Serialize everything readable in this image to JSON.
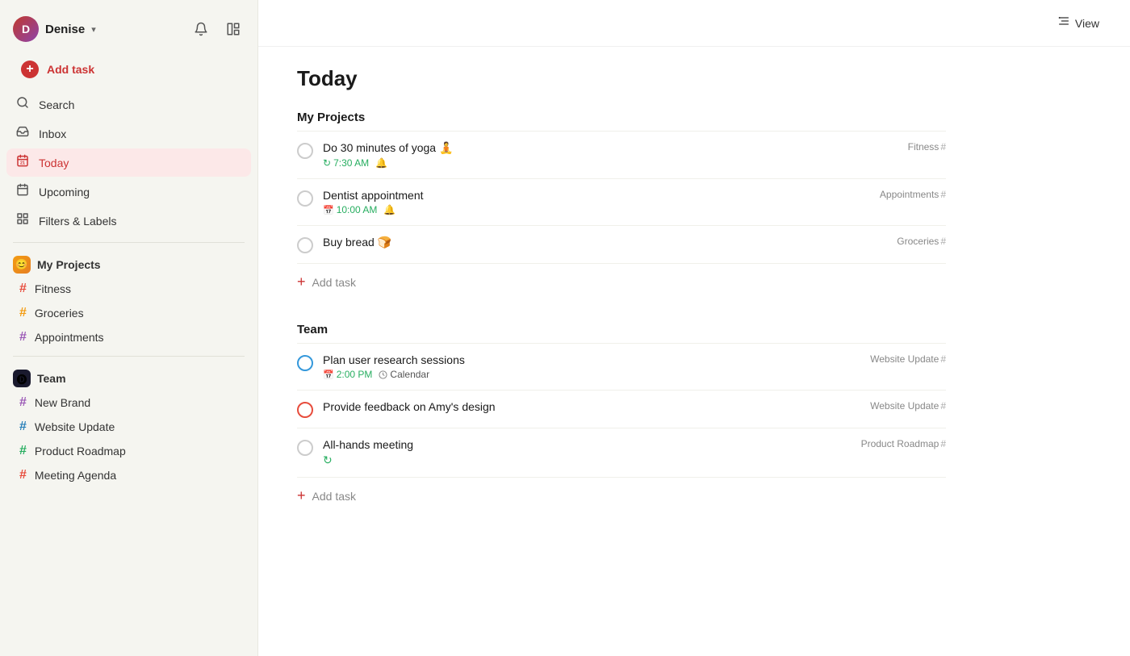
{
  "sidebar": {
    "user": {
      "name": "Denise",
      "initials": "D",
      "avatar_emoji": "😊"
    },
    "nav": [
      {
        "id": "add-task",
        "label": "Add task",
        "icon": "➕",
        "type": "action"
      },
      {
        "id": "search",
        "label": "Search",
        "icon": "🔍"
      },
      {
        "id": "inbox",
        "label": "Inbox",
        "icon": "📥"
      },
      {
        "id": "today",
        "label": "Today",
        "icon": "📅",
        "active": true
      },
      {
        "id": "upcoming",
        "label": "Upcoming",
        "icon": "📆"
      },
      {
        "id": "filters",
        "label": "Filters & Labels",
        "icon": "⊞"
      }
    ],
    "my_projects": {
      "label": "My Projects",
      "items": [
        {
          "id": "fitness",
          "label": "Fitness",
          "hash_color": "fitness"
        },
        {
          "id": "groceries",
          "label": "Groceries",
          "hash_color": "groceries"
        },
        {
          "id": "appointments",
          "label": "Appointments",
          "hash_color": "appointments"
        }
      ]
    },
    "team": {
      "label": "Team",
      "items": [
        {
          "id": "new-brand",
          "label": "New Brand",
          "hash_color": "new-brand"
        },
        {
          "id": "website-update",
          "label": "Website Update",
          "hash_color": "website"
        },
        {
          "id": "product-roadmap",
          "label": "Product Roadmap",
          "hash_color": "product"
        },
        {
          "id": "meeting-agenda",
          "label": "Meeting Agenda",
          "hash_color": "meeting"
        }
      ]
    }
  },
  "main": {
    "title": "Today",
    "view_button": "View",
    "my_projects_section": {
      "label": "My Projects",
      "tasks": [
        {
          "id": 1,
          "name": "Do 30 minutes of yoga 🧘",
          "time": "7:30 AM",
          "has_alarm": true,
          "tag": "Fitness"
        },
        {
          "id": 2,
          "name": "Dentist appointment",
          "time": "10:00 AM",
          "has_alarm": true,
          "tag": "Appointments"
        },
        {
          "id": 3,
          "name": "Buy bread 🍞",
          "time": null,
          "has_alarm": false,
          "tag": "Groceries"
        }
      ],
      "add_task_label": "Add task"
    },
    "team_section": {
      "label": "Team",
      "tasks": [
        {
          "id": 4,
          "name": "Plan user research sessions",
          "time": "2:00 PM",
          "has_calendar": true,
          "calendar_label": "Calendar",
          "tag": "Website Update",
          "ring": "blue"
        },
        {
          "id": 5,
          "name": "Provide feedback on Amy's design",
          "time": null,
          "has_calendar": false,
          "tag": "Website Update",
          "ring": "red"
        },
        {
          "id": 6,
          "name": "All-hands meeting",
          "time": null,
          "has_recurring": true,
          "tag": "Product Roadmap",
          "ring": "none"
        }
      ],
      "add_task_label": "Add task"
    }
  }
}
